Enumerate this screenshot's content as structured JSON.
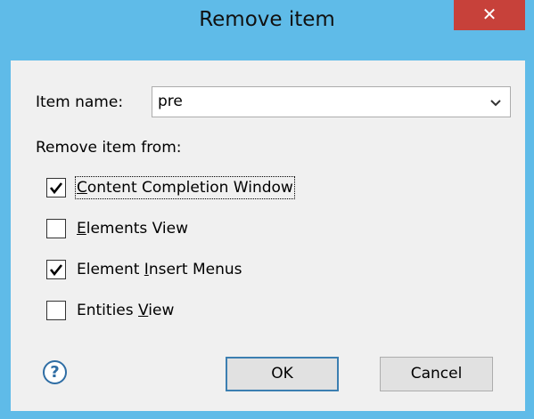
{
  "dialog": {
    "title": "Remove item",
    "close_glyph": "✕"
  },
  "item_name": {
    "label": "Item name:",
    "value": "pre"
  },
  "remove_from_label": "Remove item from:",
  "options": [
    {
      "before": "",
      "mnemonic": "C",
      "after": "ontent Completion Window",
      "checked": true
    },
    {
      "before": "",
      "mnemonic": "E",
      "after": "lements View",
      "checked": false
    },
    {
      "before": "Element ",
      "mnemonic": "I",
      "after": "nsert Menus",
      "checked": true
    },
    {
      "before": "Entities ",
      "mnemonic": "V",
      "after": "iew",
      "checked": false
    }
  ],
  "buttons": {
    "ok": "OK",
    "cancel": "Cancel"
  },
  "help_glyph": "?",
  "colors": {
    "frame": "#5fbbe8",
    "close": "#c7413a",
    "client": "#f0f0f0",
    "default_button_border": "#3c7fb1"
  },
  "icons": {
    "close": "close-icon",
    "dropdown": "chevron-down-icon",
    "help": "help-icon",
    "check": "checkmark-icon"
  }
}
